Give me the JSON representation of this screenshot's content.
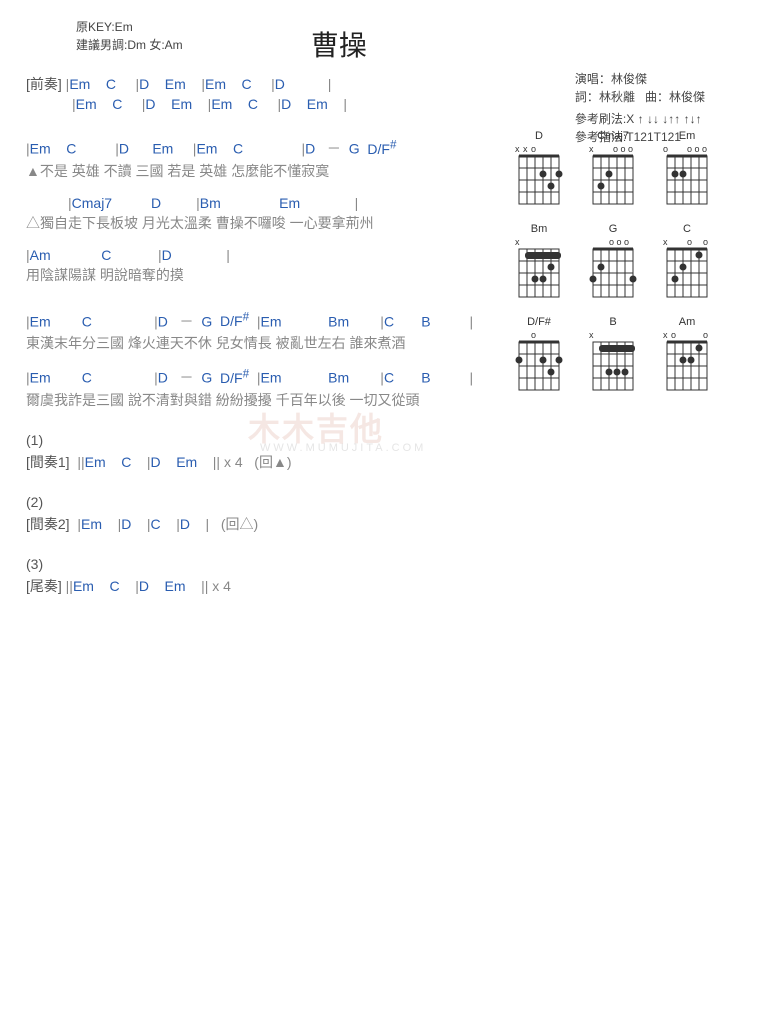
{
  "title": "曹操",
  "meta": {
    "original_key": "原KEY:Em",
    "suggested": "建議男調:Dm 女:Am",
    "performer_label": "演唱：",
    "performer": "林俊傑",
    "lyricist_label": "詞：",
    "lyricist": "林秋離",
    "composer_label": "曲：",
    "composer": "林俊傑",
    "strum_label": "參考刷法:",
    "strum": "X ↑ ↓↓ ↓↑↑ ↑↓↑",
    "fingering_label": "參考指法:",
    "fingering": "T121T121"
  },
  "intro_label": "[前奏]",
  "intro_lines": [
    "|Em    C     |D    Em    |Em    C     |D           |",
    "|Em    C     |D    Em    |Em    C     |D    Em    |"
  ],
  "verse1": {
    "chords": "|Em    C          |D      Em     |Em    C               |D   －  G  D/F#",
    "lyrics": "▲不是   英雄      不讀   三國    若是   英雄    怎麼能不懂寂寞"
  },
  "verse2": {
    "chords": "       |Cmaj7          D         |Bm               Em              |",
    "lyrics": "△獨自走下長板坡    月光太溫柔    曹操不囉唆    一心要拿荊州"
  },
  "verse3": {
    "chords": "|Am             C            |D              |",
    "lyrics": "用陰謀陽謀    明說暗奪的摸"
  },
  "chorus1": {
    "chords": "|Em        C                |D   －  G  D/F#  |Em            Bm        |C       B          |",
    "lyrics": " 東漢末年分三國    烽火連天不休           兒女情長    被亂世左右    誰來煮酒"
  },
  "chorus2": {
    "chords": "|Em        C                |D   －  G  D/F#  |Em            Bm        |C       B          |",
    "lyrics": " 爾虞我詐是三國    說不清對與錯           紛紛擾擾    千百年以後    一切又從頭"
  },
  "section1_num": "(1)",
  "interlude1_label": "[間奏1]",
  "interlude1": "||Em    C    |D    Em    || x 4   (回▲)",
  "section2_num": "(2)",
  "interlude2_label": "[間奏2]",
  "interlude2": "|Em    |D    |C    |D    |   (回△)",
  "section3_num": "(3)",
  "outro_label": "[尾奏]",
  "outro": "||Em    C    |D    Em    || x 4",
  "chord_diagrams": [
    [
      "D",
      "Cmaj7",
      "Em"
    ],
    [
      "Bm",
      "G",
      "C"
    ],
    [
      "D/F#",
      "B",
      "Am"
    ]
  ],
  "watermark": "木木吉他",
  "watermark_sub": "WWW.MUMUJITA.COM"
}
